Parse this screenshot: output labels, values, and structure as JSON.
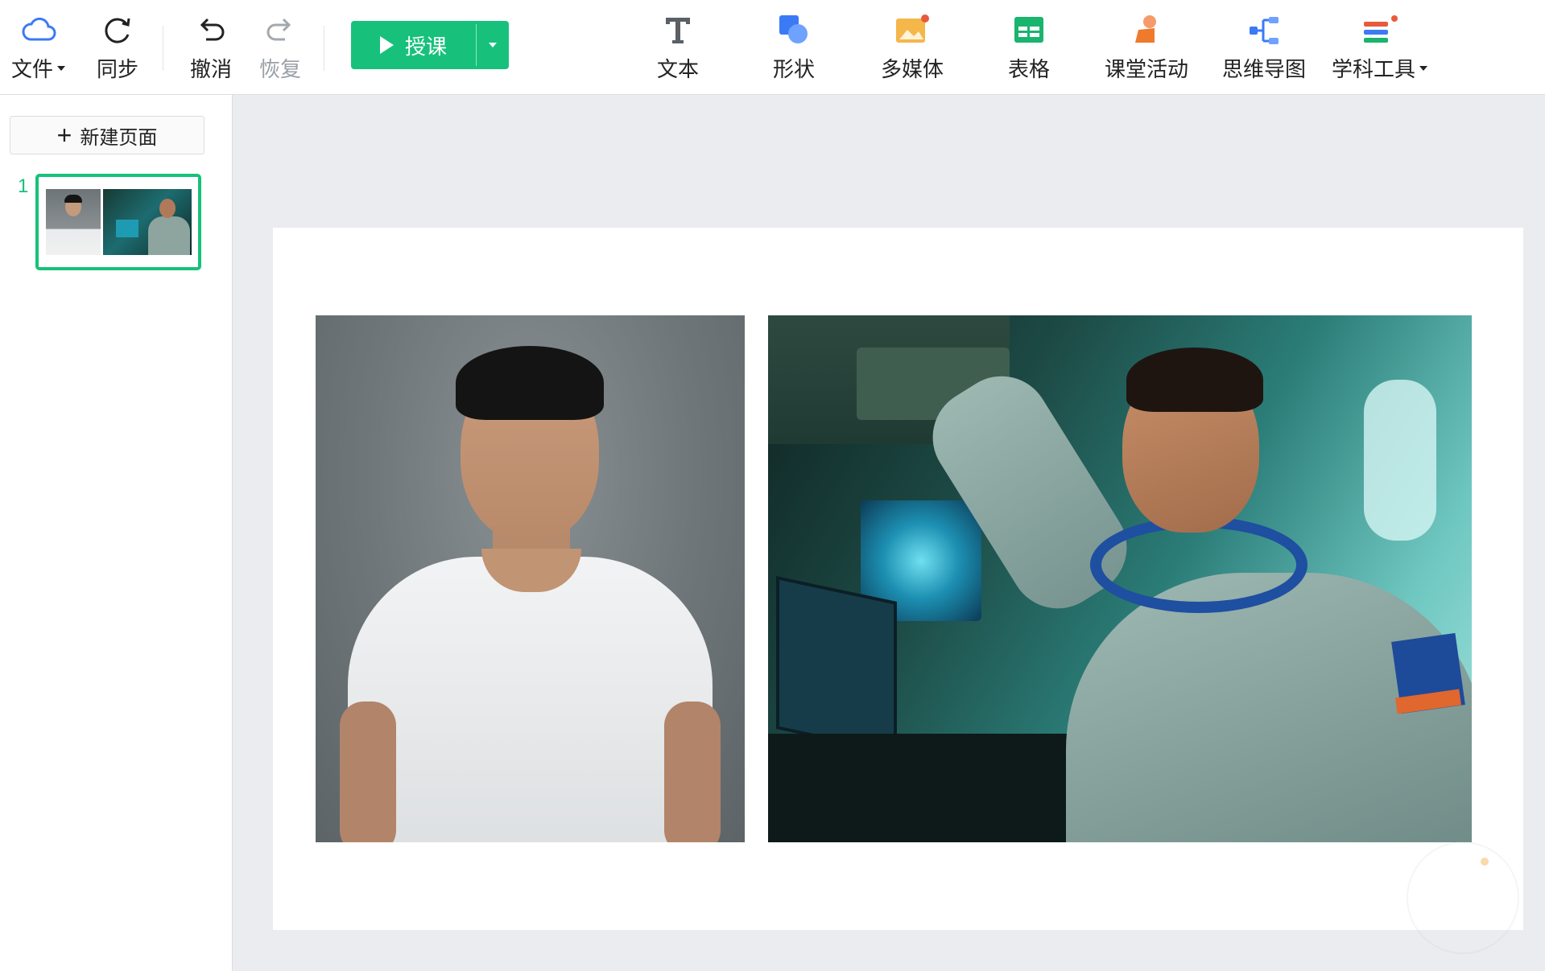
{
  "toolbar": {
    "file": "文件",
    "sync": "同步",
    "undo": "撤消",
    "redo": "恢复",
    "teach": "授课",
    "text": "文本",
    "shape": "形状",
    "media": "多媒体",
    "table": "表格",
    "activity": "课堂活动",
    "mindmap": "思维导图",
    "subject_tools": "学科工具"
  },
  "sidebar": {
    "new_page": "新建页面",
    "pages": [
      {
        "number": "1"
      }
    ]
  },
  "colors": {
    "accent": "#17c17b",
    "canvas_bg": "#ebecf0",
    "icon_blue": "#3a7bf5",
    "icon_orange": "#f5a623",
    "icon_red": "#e85a3c",
    "icon_green": "#19b46e"
  },
  "icons": {
    "file": "cloud-icon",
    "sync": "sync-icon",
    "undo": "undo-icon",
    "redo": "redo-icon",
    "text": "text-icon",
    "shape": "shape-icon",
    "media": "media-icon",
    "table": "table-icon",
    "activity": "classroom-activity-icon",
    "mindmap": "mindmap-icon",
    "subject_tools": "subject-tools-icon"
  }
}
